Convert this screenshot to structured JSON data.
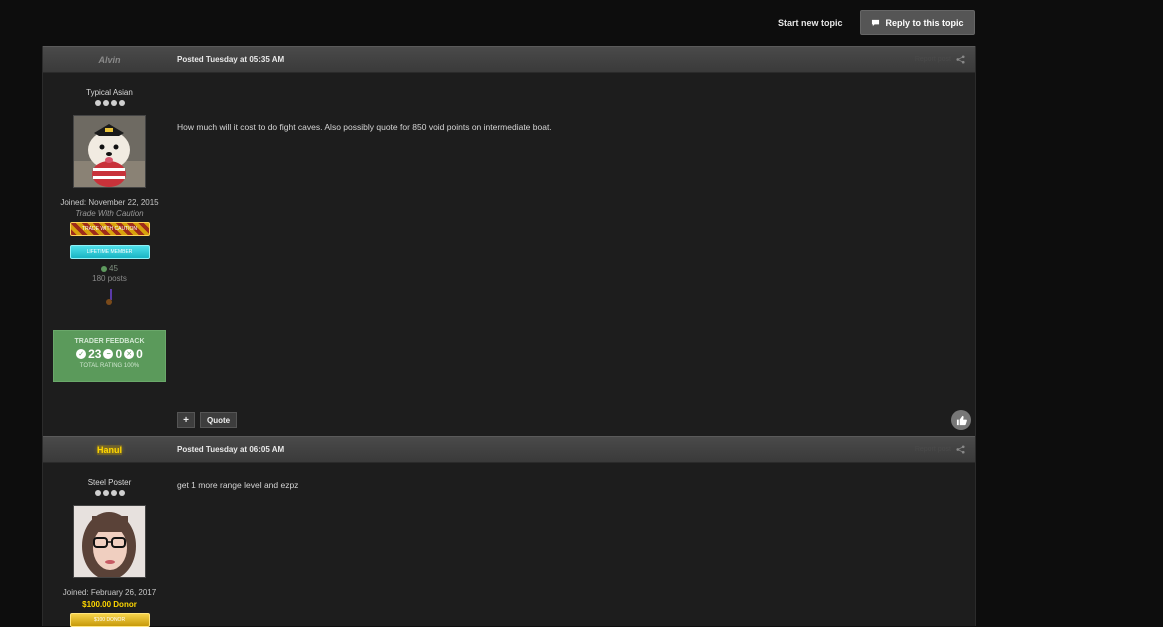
{
  "topbar": {
    "start_new_topic": "Start new topic",
    "reply_label": "Reply to this topic"
  },
  "posts": [
    {
      "author": "Alvin",
      "date": "Posted Tuesday at 05:35 AM",
      "report": "Report post",
      "rank": "Typical Asian",
      "joined": "Joined: November 22, 2015",
      "status": "Trade With Caution",
      "badge1": "TRADE WITH CAUTION",
      "badge2": "LIFETIME MEMBER",
      "reputation": "45",
      "post_count": "180 posts",
      "content": "How much will it cost to do fight caves. Also possibly quote for 850 void points on intermediate boat.",
      "feedback": {
        "title": "TRADER FEEDBACK",
        "positive": "23",
        "neutral": "0",
        "negative": "0",
        "total": "TOTAL RATING 100%"
      },
      "quote_label": "Quote",
      "plus_label": "+"
    },
    {
      "author": "Hanul",
      "date": "Posted Tuesday at 06:05 AM",
      "report": "Report post",
      "rank": "Steel Poster",
      "joined": "Joined: February 26, 2017",
      "donor": "$100.00 Donor",
      "badge1": "$100 DONOR",
      "content": "get 1 more range level and ezpz"
    }
  ],
  "colors": {
    "feedback_green": "#5b9a5b",
    "donor_gold": "#ffd700",
    "header_gray": "#444444"
  }
}
